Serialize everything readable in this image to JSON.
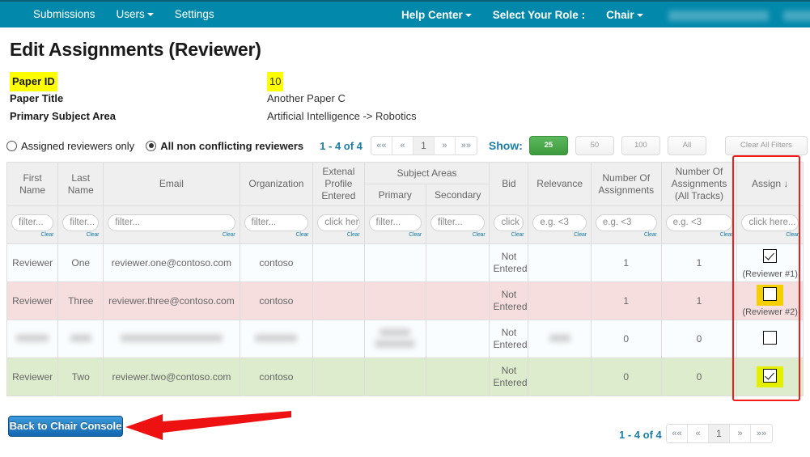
{
  "navbar": {
    "left_items": [
      {
        "label": "Submissions",
        "caret": false
      },
      {
        "label": "Users",
        "caret": true
      },
      {
        "label": "Settings",
        "caret": false
      }
    ],
    "right_items": [
      {
        "label": "Help Center",
        "caret": true,
        "bold": true
      },
      {
        "label": "Select Your Role :",
        "caret": false,
        "bold": true
      },
      {
        "label": "Chair",
        "caret": true,
        "bold": true
      }
    ],
    "brand_color": "#0288ab"
  },
  "page": {
    "title": "Edit Assignments (Reviewer)"
  },
  "meta": [
    {
      "label": "Paper ID",
      "value": "10",
      "highlight": true
    },
    {
      "label": "Paper Title",
      "value": "Another Paper C",
      "highlight": false
    },
    {
      "label": "Primary Subject Area",
      "value": "Artificial Intelligence -> Robotics",
      "highlight": false
    }
  ],
  "controls": {
    "radio_assigned_label": "Assigned reviewers only",
    "radio_assigned_selected": false,
    "radio_all_label": "All non conflicting reviewers",
    "radio_all_selected": true,
    "range_text": "1 - 4 of 4",
    "pager": [
      "««",
      "«",
      "1",
      "»",
      "»»"
    ],
    "pager_active": "1",
    "show_label": "Show:",
    "show_options": [
      "25",
      "50",
      "100",
      "All"
    ],
    "show_selected": "25",
    "clear_all_filters_label": "Clear All Filters"
  },
  "table": {
    "headers": {
      "first_name": "First Name",
      "last_name": "Last Name",
      "email": "Email",
      "organization": "Organization",
      "external_profile": "Extenal Profile Entered",
      "subject_areas": "Subject Areas",
      "primary": "Primary",
      "secondary": "Secondary",
      "bid": "Bid",
      "relevance": "Relevance",
      "num_assignments": "Number Of Assignments",
      "num_assignments_all": "Number Of Assignments (All Tracks)",
      "assign": "Assign",
      "assign_sort_arrow": "↓"
    },
    "filters": {
      "first_name": "filter...",
      "last_name": "filter...",
      "email": "filter...",
      "organization": "filter...",
      "external_profile": "click her",
      "primary": "filter...",
      "secondary": "filter...",
      "bid": "click he",
      "relevance": "e.g. <3",
      "num_assignments": "e.g. <3",
      "num_assignments_all": "e.g. <3",
      "assign": "click here..."
    },
    "clear_label": "Clear",
    "rows": [
      {
        "row_style": "r-white",
        "first_name": "Reviewer",
        "last_name": "One",
        "email": "reviewer.one@contoso.com",
        "organization": "contoso",
        "external_profile": "",
        "primary": "",
        "secondary": "",
        "bid": "Not Entered",
        "relevance": "",
        "num_assignments": "1",
        "num_assignments_all": "1",
        "assign_checked": true,
        "assign_highlight": "none",
        "assign_note": "(Reviewer #1)",
        "redacted": false
      },
      {
        "row_style": "r-pink",
        "first_name": "Reviewer",
        "last_name": "Three",
        "email": "reviewer.three@contoso.com",
        "organization": "contoso",
        "external_profile": "",
        "primary": "",
        "secondary": "",
        "bid": "Not Entered",
        "relevance": "",
        "num_assignments": "1",
        "num_assignments_all": "1",
        "assign_checked": false,
        "assign_highlight": "gold",
        "assign_note": "(Reviewer #2)",
        "redacted": false
      },
      {
        "row_style": "r-white",
        "first_name": "",
        "last_name": "",
        "email": "",
        "organization": "",
        "external_profile": "",
        "primary": "",
        "secondary": "",
        "bid": "Not Entered",
        "relevance": "",
        "num_assignments": "0",
        "num_assignments_all": "0",
        "assign_checked": false,
        "assign_highlight": "none",
        "assign_note": "",
        "redacted": true
      },
      {
        "row_style": "r-green",
        "first_name": "Reviewer",
        "last_name": "Two",
        "email": "reviewer.two@contoso.com",
        "organization": "contoso",
        "external_profile": "",
        "primary": "",
        "secondary": "",
        "bid": "Not Entered",
        "relevance": "",
        "num_assignments": "0",
        "num_assignments_all": "0",
        "assign_checked": true,
        "assign_highlight": "lime",
        "assign_note": "",
        "redacted": false
      }
    ]
  },
  "footer": {
    "back_button_label": "Back to Chair Console",
    "range_text": "1 - 4 of 4",
    "pager": [
      "««",
      "«",
      "1",
      "»",
      "»»"
    ],
    "pager_active": "1"
  },
  "annotations": {
    "assign_column_outline_color": "#f51b1b",
    "arrow_color": "#ee1111"
  }
}
